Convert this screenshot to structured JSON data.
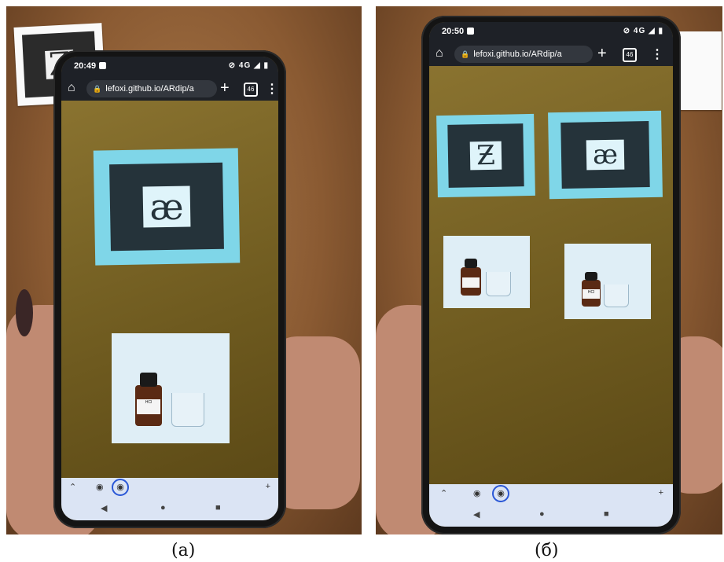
{
  "figure": {
    "panels": [
      {
        "caption": "(а)",
        "phone": {
          "time": "20:49",
          "signal": "4G",
          "url": "lefoxi.github.io/ARdip/a",
          "tab_count": "46",
          "marker_glyph": "æ",
          "bottle_label": "HCl"
        },
        "background_card_glyph": "Z"
      },
      {
        "caption": "(б)",
        "phone": {
          "time": "20:50",
          "signal": "4G",
          "url": "lefoxi.github.io/ARdip/a",
          "tab_count": "46",
          "marker_glyphs": [
            "Ƶ",
            "æ"
          ],
          "bottle_labels": [
            "",
            "HCl"
          ]
        }
      }
    ]
  },
  "colors": {
    "marker_cyan": "#7fd6e8",
    "marker_dark": "#25333a",
    "browser_bar": "#1e2127",
    "table_wood": "#8a5a32"
  },
  "icons": [
    "home-icon",
    "lock-icon",
    "plus-icon",
    "tabs-icon",
    "menu-icon",
    "back-icon",
    "home-nav-icon",
    "recents-icon"
  ]
}
